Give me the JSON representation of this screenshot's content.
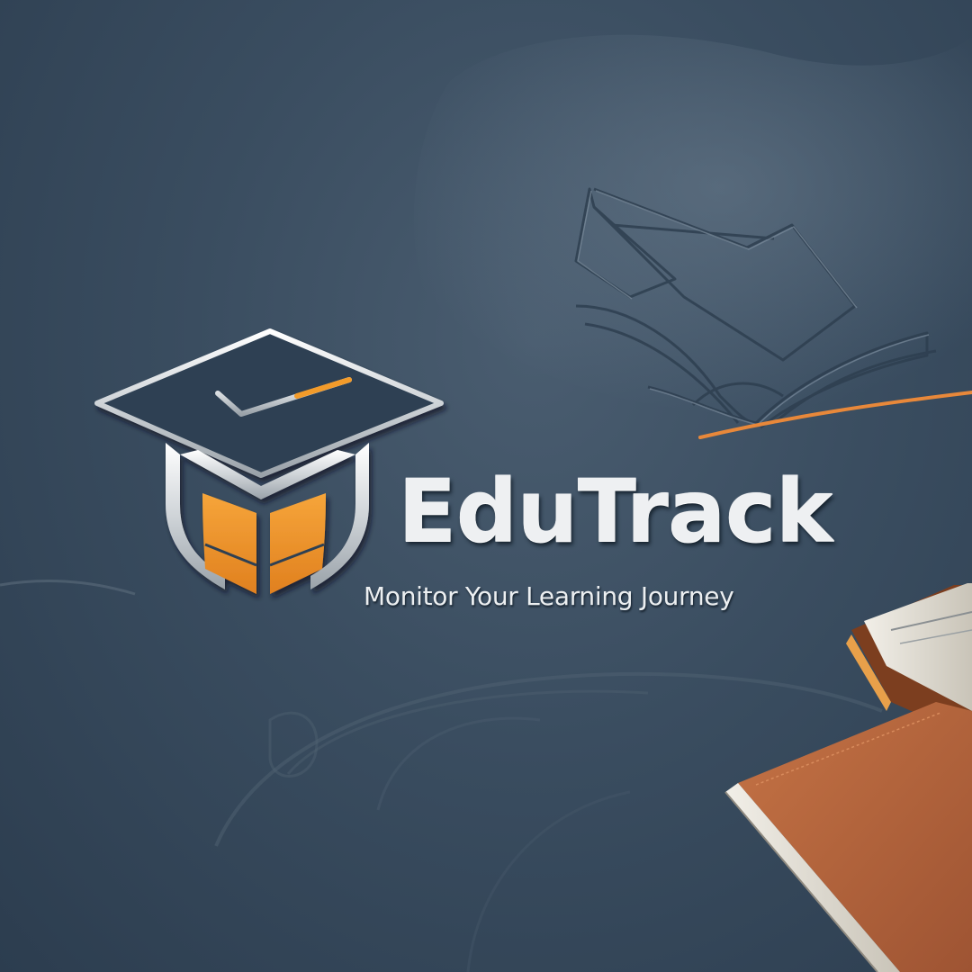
{
  "brand": {
    "name": "EduTrack",
    "tagline": "Monitor Your Learning Journey"
  },
  "colors": {
    "background": "#3a4d60",
    "accent": "#f29b2c",
    "text": "#eef0f2",
    "book_cover": "#b9683f"
  },
  "icons": {
    "logo": "graduation-cap-shield-icon",
    "open_book": "open-book-icon",
    "book_stack": "closed-books-icon"
  }
}
